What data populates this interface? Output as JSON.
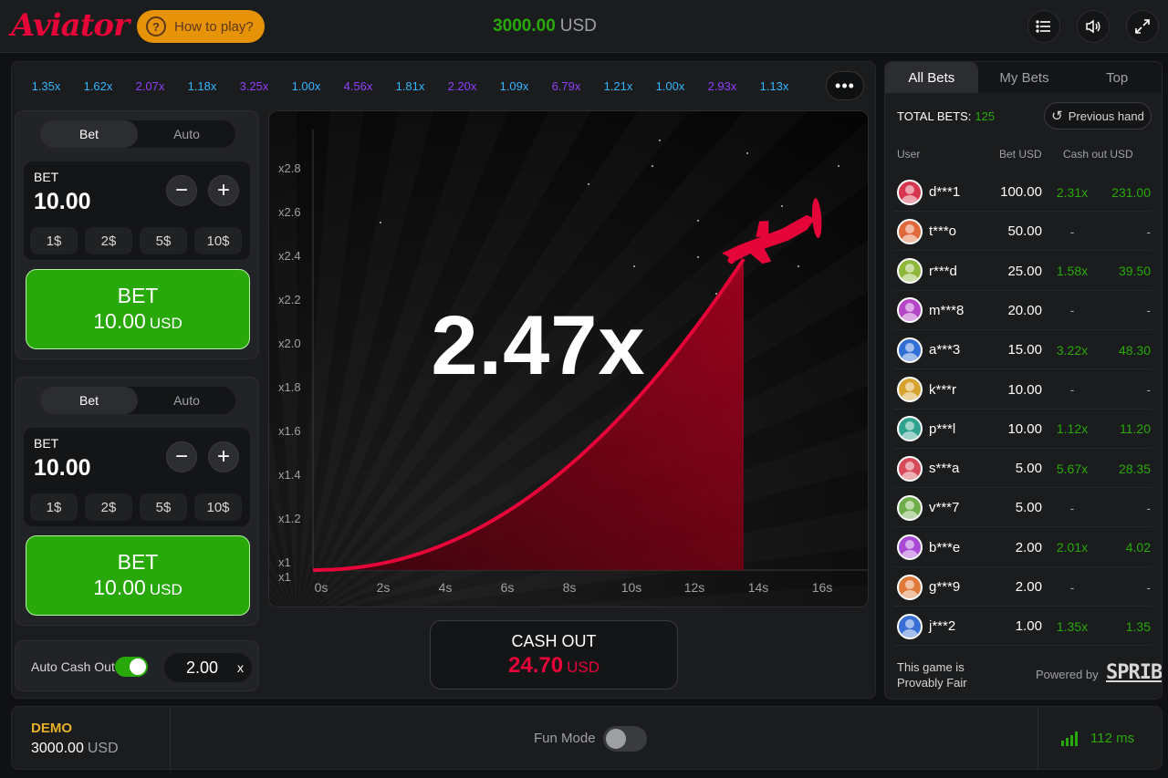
{
  "app": {
    "logo": "Aviator",
    "how_to_play": "How to play?",
    "balance_amount": "3000.00",
    "balance_currency": "USD"
  },
  "colors": {
    "accent_red": "#e50539",
    "green": "#28a909",
    "orange": "#e69308"
  },
  "history": [
    {
      "value": "1.35x",
      "color": "#34b4ff"
    },
    {
      "value": "1.62x",
      "color": "#34b4ff"
    },
    {
      "value": "2.07x",
      "color": "#913ef8"
    },
    {
      "value": "1.18x",
      "color": "#34b4ff"
    },
    {
      "value": "3.25x",
      "color": "#913ef8"
    },
    {
      "value": "1.00x",
      "color": "#34b4ff"
    },
    {
      "value": "4.56x",
      "color": "#913ef8"
    },
    {
      "value": "1.81x",
      "color": "#34b4ff"
    },
    {
      "value": "2.20x",
      "color": "#913ef8"
    },
    {
      "value": "1.09x",
      "color": "#34b4ff"
    },
    {
      "value": "6.79x",
      "color": "#913ef8"
    },
    {
      "value": "1.21x",
      "color": "#34b4ff"
    },
    {
      "value": "1.00x",
      "color": "#34b4ff"
    },
    {
      "value": "2.93x",
      "color": "#913ef8"
    },
    {
      "value": "1.13x",
      "color": "#34b4ff"
    }
  ],
  "bet_panels": [
    {
      "tab_bet": "Bet",
      "tab_auto": "Auto",
      "bet_label": "BET",
      "bet_value": "10.00",
      "minus": "−",
      "plus": "+",
      "quick": [
        "1$",
        "2$",
        "5$",
        "10$"
      ],
      "button_line1": "BET",
      "button_amount": "10.00",
      "button_currency": "USD"
    },
    {
      "tab_bet": "Bet",
      "tab_auto": "Auto",
      "bet_label": "BET",
      "bet_value": "10.00",
      "minus": "−",
      "plus": "+",
      "quick": [
        "1$",
        "2$",
        "5$",
        "10$"
      ],
      "button_line1": "BET",
      "button_amount": "10.00",
      "button_currency": "USD"
    }
  ],
  "auto_cash_out": {
    "label": "Auto Cash Out",
    "enabled": true,
    "value": "2.00",
    "clear": "x"
  },
  "game": {
    "multiplier": "2.47x",
    "y_ticks": [
      "x2.8",
      "x2.6",
      "x2.4",
      "x2.2",
      "x2.0",
      "x1.8",
      "x1.6",
      "x1.4",
      "x1.2",
      "x1",
      "x1"
    ],
    "x_ticks": [
      "0s",
      "2s",
      "4s",
      "6s",
      "8s",
      "10s",
      "12s",
      "14s",
      "16s"
    ]
  },
  "cash_out": {
    "label": "CASH OUT",
    "amount": "24.70",
    "currency": "USD"
  },
  "bets_panel": {
    "tabs": [
      "All Bets",
      "My Bets",
      "Top"
    ],
    "total_label": "TOTAL BETS:",
    "total_value": "125",
    "previous_hand": "Previous hand",
    "col_user": "User",
    "col_bet": "Bet USD",
    "col_cashout": "Cash out USD",
    "rows": [
      {
        "user": "d***1",
        "bet": "100.00",
        "mult": "2.31x",
        "cashout": "231.00",
        "avatar": "#d6374f"
      },
      {
        "user": "t***o",
        "bet": "50.00",
        "mult": "-",
        "cashout": "-",
        "avatar": "#e0683a"
      },
      {
        "user": "r***d",
        "bet": "25.00",
        "mult": "1.58x",
        "cashout": "39.50",
        "avatar": "#8fb83a"
      },
      {
        "user": "m***8",
        "bet": "20.00",
        "mult": "-",
        "cashout": "-",
        "avatar": "#b445c7"
      },
      {
        "user": "a***3",
        "bet": "15.00",
        "mult": "3.22x",
        "cashout": "48.30",
        "avatar": "#2f6fd6"
      },
      {
        "user": "k***r",
        "bet": "10.00",
        "mult": "-",
        "cashout": "-",
        "avatar": "#d6a32f"
      },
      {
        "user": "p***l",
        "bet": "10.00",
        "mult": "1.12x",
        "cashout": "11.20",
        "avatar": "#2fa38f"
      },
      {
        "user": "s***a",
        "bet": "5.00",
        "mult": "5.67x",
        "cashout": "28.35",
        "avatar": "#d64a5a"
      },
      {
        "user": "v***7",
        "bet": "5.00",
        "mult": "-",
        "cashout": "-",
        "avatar": "#6fae4a"
      },
      {
        "user": "b***e",
        "bet": "2.00",
        "mult": "2.01x",
        "cashout": "4.02",
        "avatar": "#a94ad6"
      },
      {
        "user": "g***9",
        "bet": "2.00",
        "mult": "-",
        "cashout": "-",
        "avatar": "#e07a3a"
      },
      {
        "user": "j***2",
        "bet": "1.00",
        "mult": "1.35x",
        "cashout": "1.35",
        "avatar": "#3a6fd6"
      }
    ],
    "fair_line1": "This game is",
    "fair_line2": "Provably Fair",
    "powered_by": "Powered by",
    "spribe": "SPRIBE"
  },
  "footer": {
    "demo_label": "DEMO",
    "demo_balance": "3000.00",
    "demo_currency": "USD",
    "fun_mode": "Fun Mode",
    "fun_enabled": false,
    "ping": "112 ms"
  }
}
